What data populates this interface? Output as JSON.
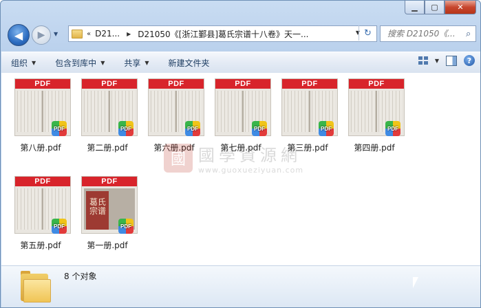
{
  "window": {
    "minimize": "▁",
    "maximize": "▢",
    "close": "✕"
  },
  "nav": {
    "back_glyph": "◀",
    "forward_glyph": "▶",
    "address_chevron": "«",
    "crumb_1": "D21...",
    "crumb_2": "D21050《[浙江鄞县]葛氏宗谱十八卷》天一...",
    "refresh_glyph": "↻",
    "search_placeholder": "搜索 D21050《...",
    "search_glyph": "⌕"
  },
  "toolbar": {
    "organize": "组织",
    "include_library": "包含到库中",
    "share": "共享",
    "new_folder": "新建文件夹",
    "help": "?"
  },
  "pdf_band_label": "PDF",
  "badge_label": "PDF",
  "cover_text": "葛氏宗谱",
  "files": [
    {
      "name": "第八册.pdf"
    },
    {
      "name": "第二册.pdf"
    },
    {
      "name": "第六册.pdf"
    },
    {
      "name": "第七册.pdf"
    },
    {
      "name": "第三册.pdf"
    },
    {
      "name": "第四册.pdf"
    },
    {
      "name": "第五册.pdf"
    },
    {
      "name": "第一册.pdf"
    }
  ],
  "watermark": {
    "seal": "國",
    "title": "國學資源網",
    "url": "www.guoxueziyuan.com"
  },
  "status": {
    "count_text": "8 个对象"
  },
  "colors": {
    "pdf_red": "#d8242b",
    "accent_blue": "#2c6cc0"
  }
}
